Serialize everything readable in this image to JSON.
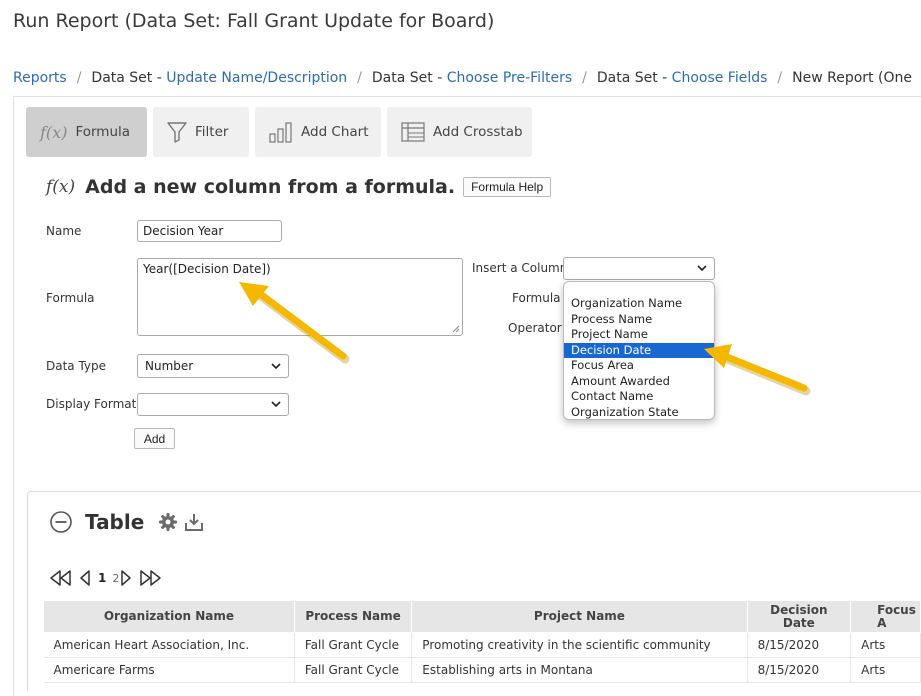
{
  "page": {
    "title": "Run Report (Data Set: Fall Grant Update for Board)"
  },
  "breadcrumb": {
    "reports": "Reports",
    "ds_prefix_1": "Data Set - ",
    "update_name": "Update Name/Description",
    "ds_prefix_2": "Data Set - ",
    "prefilters": "Choose Pre-Filters",
    "ds_prefix_3": "Data Set - ",
    "fields": "Choose Fields",
    "current": "New Report (One",
    "separator": "/"
  },
  "toolbar": {
    "formula_label": "Formula",
    "filter_label": "Filter",
    "add_chart_label": "Add Chart",
    "add_crosstab_label": "Add Crosstab",
    "fx_glyph": "f(x)",
    "icons": [
      "formula-icon",
      "filter-icon",
      "chart-icon",
      "crosstab-icon"
    ]
  },
  "formula_section": {
    "heading": "Add a new column from a formula.",
    "help_button": "Formula Help",
    "name_label": "Name",
    "name_value": "Decision Year",
    "formula_label": "Formula",
    "formula_value": "Year([Decision Date])",
    "insert_column_label": "Insert a Column",
    "insert_column_value": "",
    "formula_label_2": "Formula",
    "operator_label": "Operator",
    "data_type_label": "Data Type",
    "data_type_value": "Number",
    "display_format_label": "Display Format",
    "display_format_value": "",
    "add_button": "Add"
  },
  "column_dropdown": {
    "options": [
      "Organization Name",
      "Process Name",
      "Project Name",
      "Decision Date",
      "Focus Area",
      "Amount Awarded",
      "Contact Name",
      "Organization State"
    ],
    "selected": "Decision Date",
    "highlight_color": "#1967d2"
  },
  "annotation": {
    "arrow_color": "#f5b800"
  },
  "table_section": {
    "title": "Table",
    "pager": {
      "pages": [
        "1",
        "2"
      ],
      "current": "1"
    },
    "columns": [
      "Organization Name",
      "Process Name",
      "Project Name",
      "Decision Date",
      "Focus A"
    ],
    "rows": [
      [
        "American Heart Association, Inc.",
        "Fall Grant Cycle",
        "Promoting creativity in the scientific community",
        "8/15/2020",
        "Arts"
      ],
      [
        "Americare Farms",
        "Fall Grant Cycle",
        "Establishing arts in Montana",
        "8/15/2020",
        "Arts"
      ]
    ]
  },
  "colors": {
    "link": "#2b6cb0",
    "active_tool": "#cfcfcf",
    "tool": "#f0f0f0",
    "header_bg": "#e6e6e6"
  }
}
